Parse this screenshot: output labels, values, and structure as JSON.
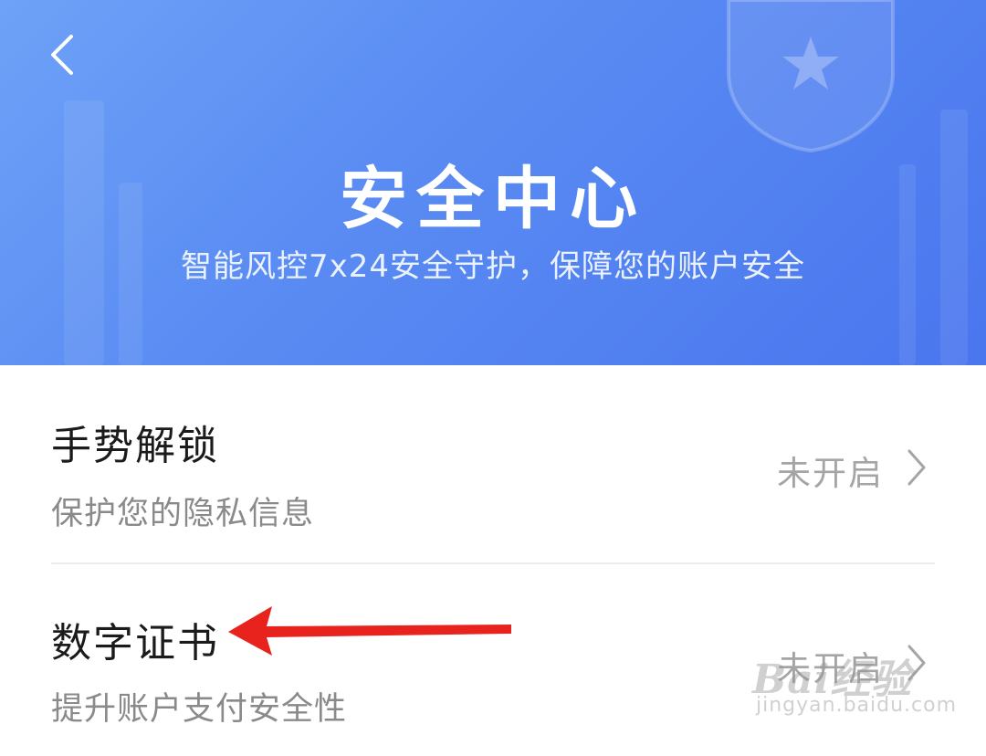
{
  "header": {
    "title": "安全中心",
    "subtitle": "智能风控7x24安全守护，保障您的账户安全"
  },
  "settings": [
    {
      "title": "手势解锁",
      "description": "保护您的隐私信息",
      "status": "未开启"
    },
    {
      "title": "数字证书",
      "description": "提升账户支付安全性",
      "status": "未开启"
    }
  ],
  "watermark": {
    "text": "Bai经验",
    "url": "jingyan.baidu.com"
  },
  "colors": {
    "header_gradient_start": "#6ea2f7",
    "header_gradient_end": "#4a76ee",
    "annotation_arrow": "#e8231d",
    "status_text": "#a5a5a5"
  },
  "icons": {
    "back": "chevron-left-icon",
    "shield": "shield-star-icon",
    "row_chevron": "chevron-right-icon",
    "annotation": "red-arrow-icon"
  }
}
